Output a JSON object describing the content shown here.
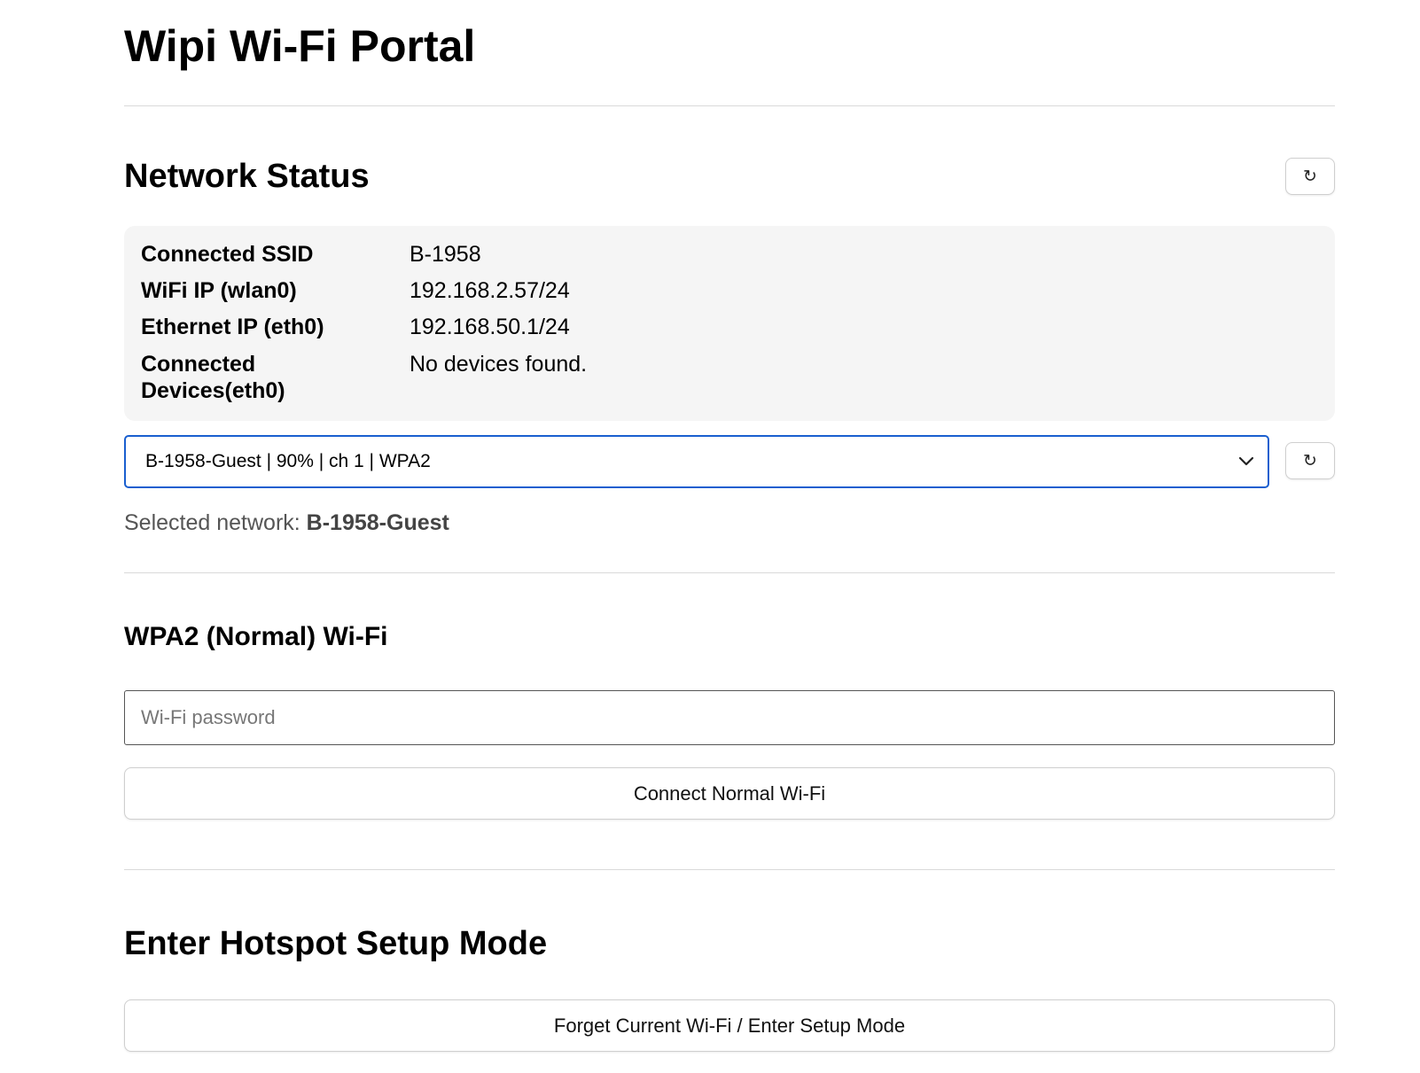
{
  "app": {
    "title": "Wipi Wi-Fi Portal"
  },
  "network_status": {
    "title": "Network Status",
    "refresh_icon": "refresh-icon",
    "refresh_glyph": "↻",
    "rows": [
      {
        "key": "Connected SSID",
        "value": "B-1958"
      },
      {
        "key": "WiFi IP (wlan0)",
        "value": "192.168.2.57/24"
      },
      {
        "key": "Ethernet IP (eth0)",
        "value": "192.168.50.1/24"
      },
      {
        "key": "Connected Devices(eth0)",
        "value": "No devices found."
      }
    ]
  },
  "network_picker": {
    "selected_option": "B-1958-Guest | 90% | ch 1 | WPA2",
    "refresh_glyph": "↻",
    "selected_label": "Selected network:",
    "selected_value": "B-1958-Guest"
  },
  "wpa2": {
    "title": "WPA2 (Normal) Wi-Fi",
    "password_placeholder": "Wi-Fi password",
    "password_value": "",
    "connect_label": "Connect Normal Wi-Fi"
  },
  "hotspot": {
    "title": "Enter Hotspot Setup Mode",
    "forget_label": "Forget Current Wi-Fi / Enter Setup Mode"
  },
  "colors": {
    "accent": "#1a5fcf",
    "panel_bg": "#f5f5f5",
    "divider": "#d9d9d9"
  }
}
